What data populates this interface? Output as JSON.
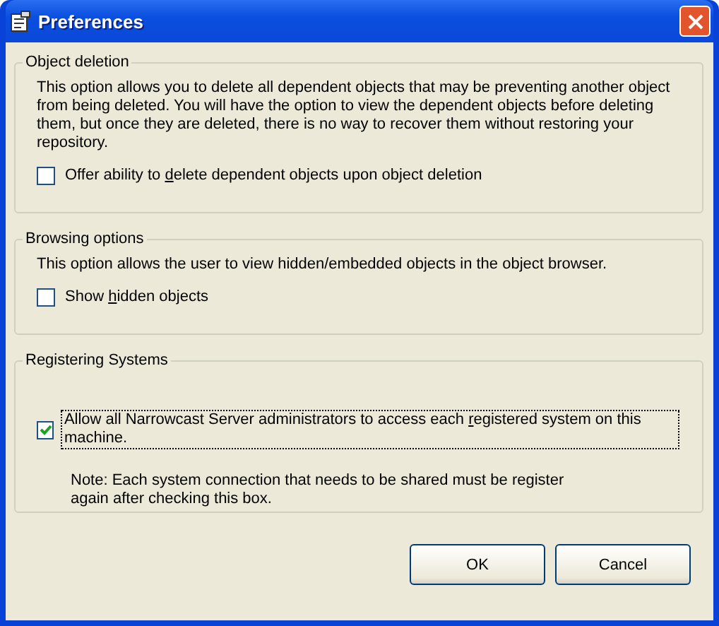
{
  "window": {
    "title": "Preferences"
  },
  "groups": [
    {
      "title": "Object deletion",
      "description": "This option allows you to delete all dependent objects that may be preventing another object from being deleted. You will have the option to view the dependent objects before deleting them, but once they are deleted, there is no way to recover them without restoring your repository.",
      "checkbox": {
        "label": {
          "before": "Offer ability to ",
          "key": "d",
          "after": "elete dependent objects upon object deletion"
        },
        "checked": false,
        "focused": false
      }
    },
    {
      "title": "Browsing options",
      "description": "This option allows the user to view hidden/embedded objects in the object browser.",
      "checkbox": {
        "label": {
          "before": "Show ",
          "key": "h",
          "after": "idden objects"
        },
        "checked": false,
        "focused": false
      }
    },
    {
      "title": "Registering Systems",
      "checkbox": {
        "label": {
          "before": "Allow all Narrowcast Server administrators to access each ",
          "key": "r",
          "after": "egistered system on this machine."
        },
        "checked": true,
        "focused": true
      },
      "note": "Note: Each system connection that needs to be shared must be register again after checking this box."
    }
  ],
  "buttons": [
    {
      "label": "OK"
    },
    {
      "label": "Cancel"
    }
  ]
}
